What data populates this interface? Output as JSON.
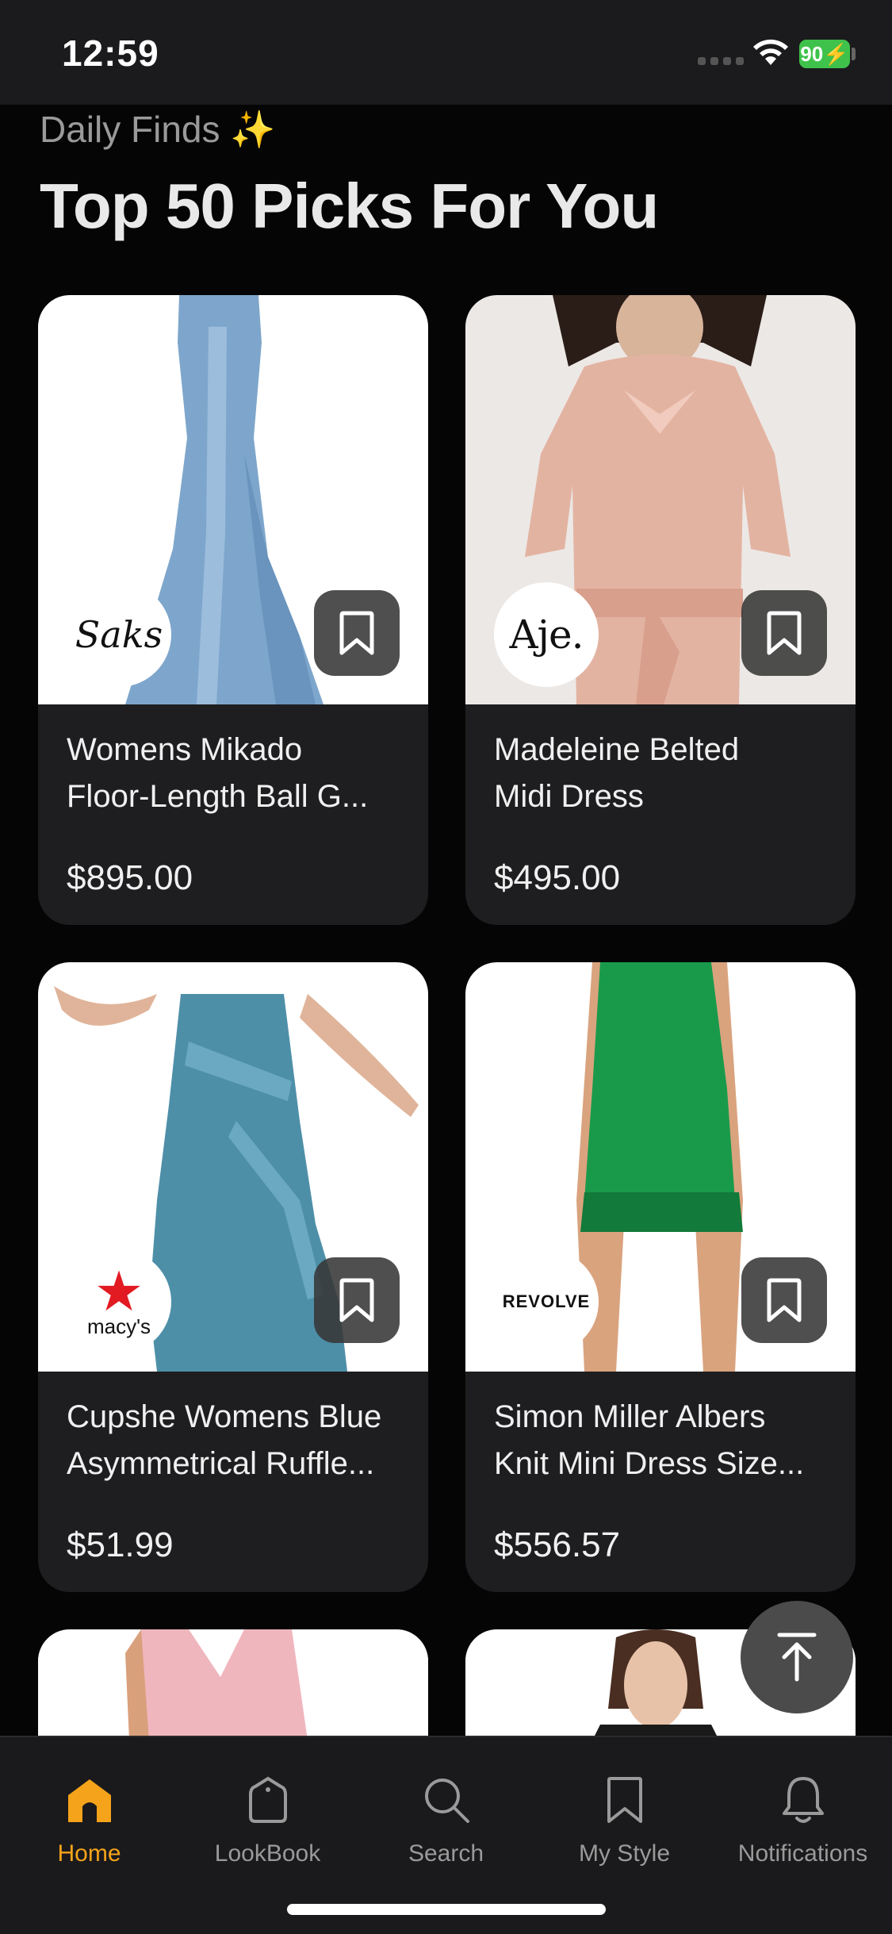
{
  "status_bar": {
    "time": "12:59",
    "battery": "90"
  },
  "header": {
    "eyebrow": "Daily Finds",
    "eyebrow_sparkle": "✨",
    "title": "Top 50 Picks For You"
  },
  "products": [
    {
      "name": "Womens Mikado\nFloor-Length Ball G...",
      "price": "$895.00",
      "retailer": "Saks"
    },
    {
      "name": "Madeleine Belted\nMidi Dress",
      "price": "$495.00",
      "retailer": "Aje."
    },
    {
      "name": "Cupshe Womens Blue\nAsymmetrical Ruffle...",
      "price": "$51.99",
      "retailer": "macy's"
    },
    {
      "name": "Simon Miller Albers\nKnit Mini Dress Size...",
      "price": "$556.57",
      "retailer": "REVOLVE"
    }
  ],
  "icons": {
    "bookmark": "bookmark-icon",
    "scroll_top": "arrow-up-to-top-icon"
  },
  "tab_bar": {
    "tabs": [
      {
        "label": "Home",
        "icon": "home-icon",
        "active": true
      },
      {
        "label": "LookBook",
        "icon": "tag-icon",
        "active": false
      },
      {
        "label": "Search",
        "icon": "search-icon",
        "active": false
      },
      {
        "label": "My Style",
        "icon": "bookmark-icon",
        "active": false
      },
      {
        "label": "Notifications",
        "icon": "bell-icon",
        "active": false
      }
    ]
  },
  "colors": {
    "accent": "#f5a31a",
    "background": "#050505",
    "card": "#1e1e20",
    "battery": "#3fc24b"
  }
}
